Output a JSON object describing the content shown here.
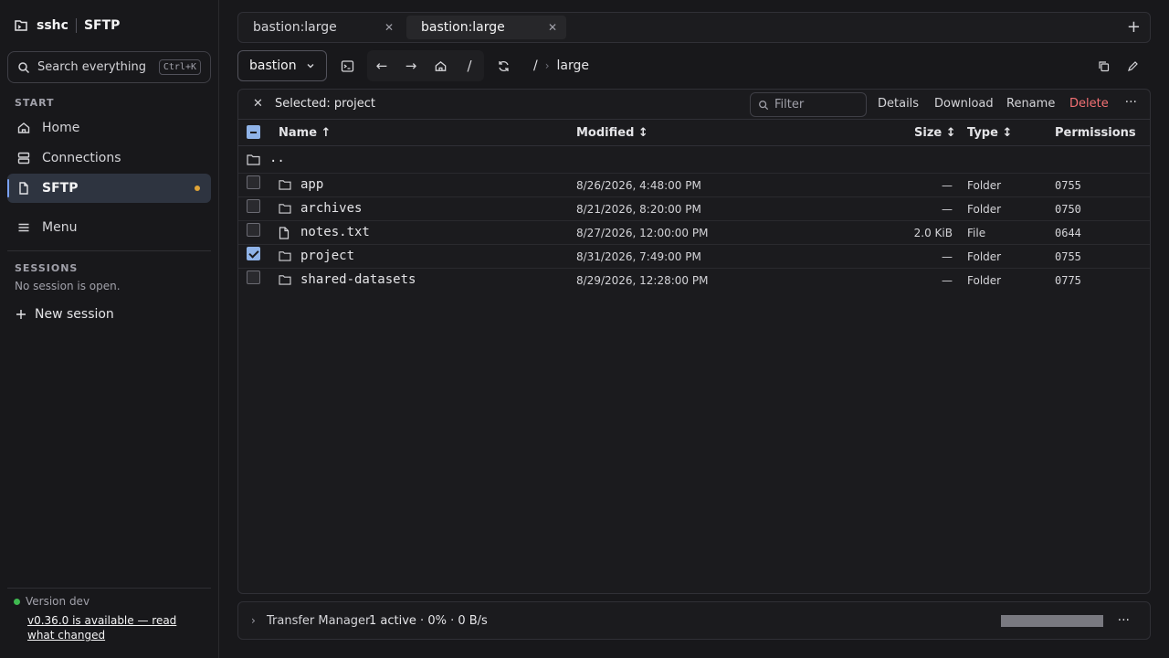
{
  "brand": {
    "app": "sshc",
    "section": "SFTP"
  },
  "search": {
    "placeholder": "Search everything",
    "shortcut": "Ctrl+K"
  },
  "sidebar": {
    "start_label": "START",
    "items": [
      {
        "label": "Home",
        "icon": "home-icon"
      },
      {
        "label": "Connections",
        "icon": "server-icon"
      },
      {
        "label": "SFTP",
        "icon": "file-icon",
        "active": true
      },
      {
        "label": "Menu",
        "icon": "menu-icon"
      }
    ],
    "sessions_label": "SESSIONS",
    "no_session": "No session is open.",
    "new_session": "New session",
    "version": "Version dev",
    "update_notice": "v0.36.0 is available — read what changed"
  },
  "tabs": [
    {
      "label": "bastion:large",
      "active": false
    },
    {
      "label": "bastion:large",
      "active": true
    }
  ],
  "toolbar": {
    "host": "bastion",
    "root": "/",
    "path_root": "/",
    "path_current": "large"
  },
  "selection": {
    "text": "Selected: project",
    "filter_placeholder": "Filter",
    "actions": [
      "Details",
      "Download",
      "Rename",
      "Delete"
    ]
  },
  "table": {
    "headers": {
      "name": "Name ↑",
      "modified": "Modified ↕",
      "size": "Size ↕",
      "type": "Type ↕",
      "permissions": "Permissions"
    },
    "parent": "..",
    "rows": [
      {
        "name": "app",
        "modified": "8/26/2026, 4:48:00 PM",
        "size": "—",
        "type": "Folder",
        "perm": "0755",
        "icon": "folder-icon",
        "checked": false
      },
      {
        "name": "archives",
        "modified": "8/21/2026, 8:20:00 PM",
        "size": "—",
        "type": "Folder",
        "perm": "0750",
        "icon": "folder-icon",
        "checked": false
      },
      {
        "name": "notes.txt",
        "modified": "8/27/2026, 12:00:00 PM",
        "size": "2.0 KiB",
        "type": "File",
        "perm": "0644",
        "icon": "file-icon",
        "checked": false
      },
      {
        "name": "project",
        "modified": "8/31/2026, 7:49:00 PM",
        "size": "—",
        "type": "Folder",
        "perm": "0755",
        "icon": "folder-icon",
        "checked": true
      },
      {
        "name": "shared-datasets",
        "modified": "8/29/2026, 12:28:00 PM",
        "size": "—",
        "type": "Folder",
        "perm": "0775",
        "icon": "folder-icon",
        "checked": false
      }
    ]
  },
  "transfer": {
    "title": "Transfer Manager",
    "stats": "1 active · 0% · 0 B/s",
    "progress": 0
  },
  "colors": {
    "accent": "#8fb3e8",
    "danger": "#f47174",
    "status_dot": "#e0a437",
    "online": "#3fb950"
  }
}
